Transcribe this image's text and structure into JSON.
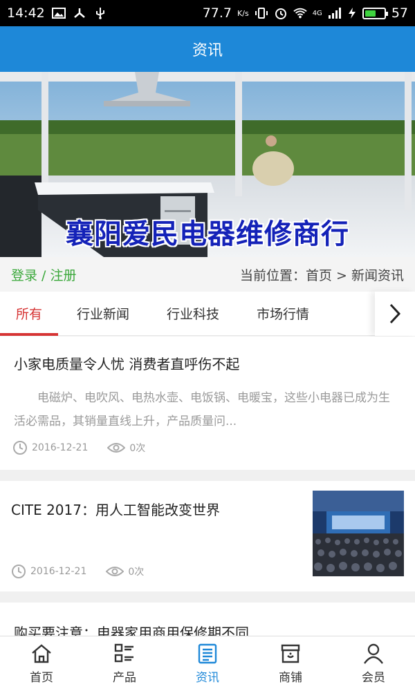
{
  "status": {
    "time": "14:42",
    "speed": "77.7",
    "speed_unit": "K/s",
    "network": "4G",
    "battery": "57",
    "battery_level": 0.57
  },
  "header": {
    "title": "资讯"
  },
  "banner": {
    "headline": "襄阳爱民电器维修商行"
  },
  "location": {
    "login": "登录 / 注册",
    "breadcrumb": "当前位置：首页 > 新闻资讯"
  },
  "tabs": [
    {
      "label": "所有",
      "active": true
    },
    {
      "label": "行业新闻",
      "active": false
    },
    {
      "label": "行业科技",
      "active": false
    },
    {
      "label": "市场行情",
      "active": false
    }
  ],
  "articles": [
    {
      "title": "小家电质量令人忧 消费者直呼伤不起",
      "summary": "电磁炉、电吹风、电热水壶、电饭锅、电暖宝，这些小电器已成为生活必需品，其销量直线上升，产品质量问...",
      "date": "2016-12-21",
      "views": "0次"
    },
    {
      "title": "CITE 2017：用人工智能改变世界",
      "date": "2016-12-21",
      "views": "0次"
    },
    {
      "title": "购买要注意：电器家用商用保修期不同"
    }
  ],
  "tabbar": [
    {
      "label": "首页",
      "icon": "home-icon",
      "active": false
    },
    {
      "label": "产品",
      "icon": "list-icon",
      "active": false
    },
    {
      "label": "资讯",
      "icon": "news-icon",
      "active": true
    },
    {
      "label": "商铺",
      "icon": "store-icon",
      "active": false
    },
    {
      "label": "会员",
      "icon": "user-icon",
      "active": false
    }
  ],
  "colors": {
    "accent": "#1e88d8",
    "tab_active": "#d63434",
    "login": "#3aa83a",
    "banner_text": "#1422b8"
  }
}
